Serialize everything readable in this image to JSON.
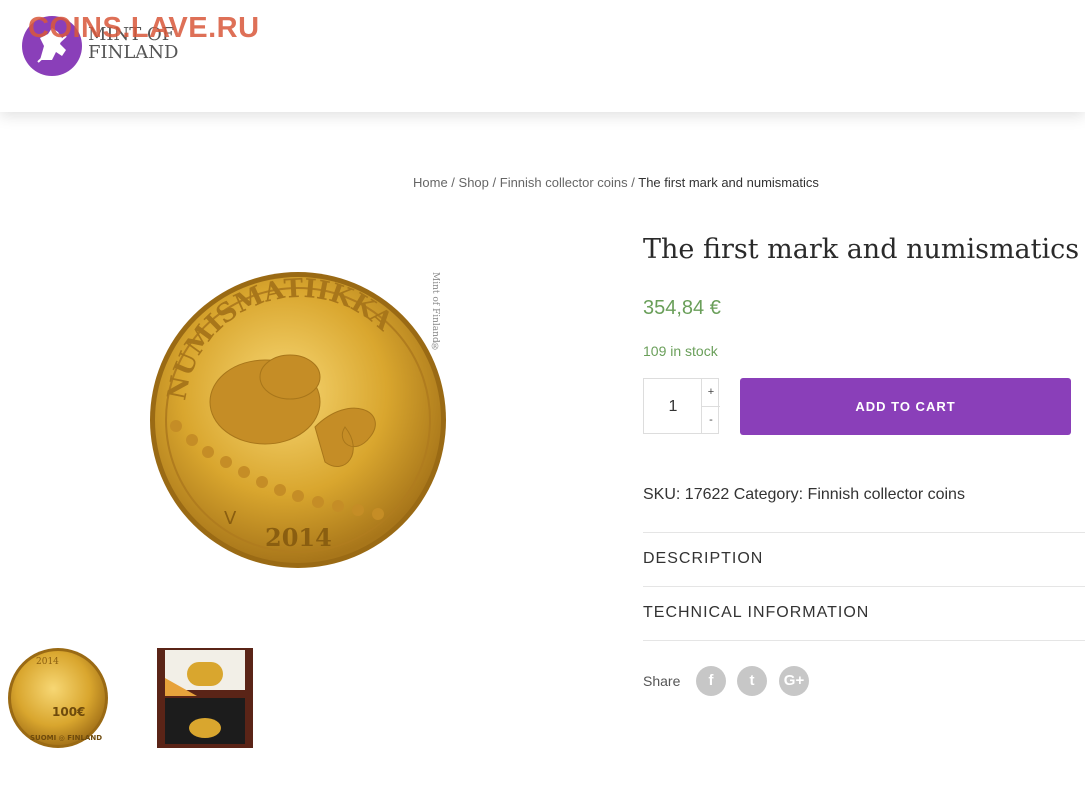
{
  "watermark": "COINS.LAVE.RU",
  "logo": {
    "line1": "MINT OF",
    "line2": "FINLAND"
  },
  "breadcrumb": {
    "home": "Home",
    "sep": " / ",
    "shop": "Shop",
    "category": "Finnish collector coins",
    "current": "The first mark and numismatics"
  },
  "coin": {
    "inscription": "NUMISMATIIKKA",
    "year": "2014",
    "mintmark": "V",
    "side_text": "Mint of Finland®"
  },
  "thumb": {
    "year": "2014",
    "value": "100€",
    "text": "SUOMI ◎ FINLAND"
  },
  "product": {
    "title": "The first mark and numismatics",
    "price": "354,84 €",
    "stock": "109 in stock",
    "quantity": "1",
    "plus": "+",
    "minus": "-",
    "add_to_cart": "ADD TO CART",
    "meta": "SKU: 17622 Category: Finnish collector coins"
  },
  "tabs": [
    "DESCRIPTION",
    "TECHNICAL INFORMATION"
  ],
  "share": {
    "label": "Share",
    "icons": [
      "facebook-icon",
      "twitter-icon",
      "google-plus-icon"
    ],
    "glyphs": [
      "f",
      "t",
      "G+"
    ]
  },
  "colors": {
    "accent": "#8a3fb9",
    "price": "#6a9f5a",
    "watermark": "#d9583a"
  }
}
